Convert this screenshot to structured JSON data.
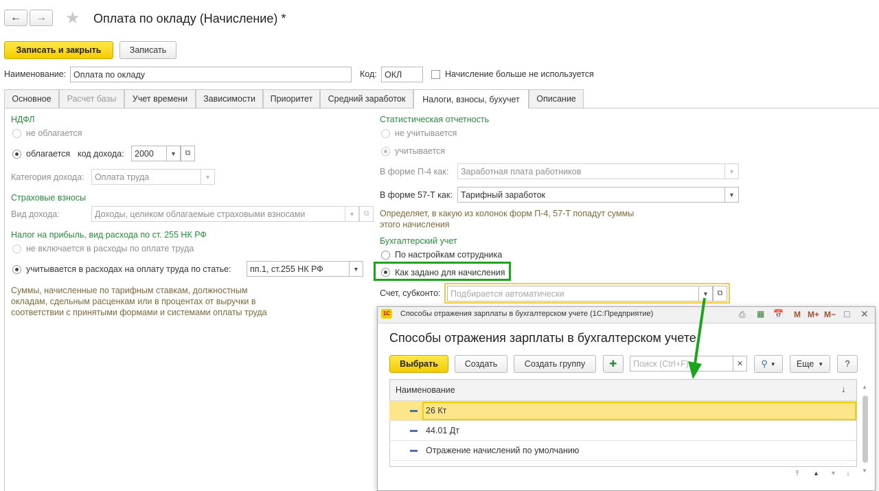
{
  "header": {
    "back_icon": "arrow-left-icon",
    "forward_icon": "arrow-right-icon",
    "star_icon": "star-icon",
    "title": "Оплата по окладу (Начисление) *"
  },
  "toolbar": {
    "save_close": "Записать и закрыть",
    "save": "Записать"
  },
  "top_fields": {
    "name_label": "Наименование:",
    "name_value": "Оплата по окладу",
    "code_label": "Код:",
    "code_value": "ОКЛ",
    "unused_label": "Начисление больше не используется"
  },
  "tabs": [
    "Основное",
    "Расчет базы",
    "Учет времени",
    "Зависимости",
    "Приоритет",
    "Средний заработок",
    "Налоги, взносы, бухучет",
    "Описание"
  ],
  "left": {
    "ndfl_title": "НДФЛ",
    "not_taxed": "не облагается",
    "taxed": "облагается",
    "income_code_label": "код дохода:",
    "income_code_value": "2000",
    "income_category_label": "Категория дохода:",
    "income_category_value": "Оплата труда",
    "insurance_title": "Страховые взносы",
    "income_kind_label": "Вид дохода:",
    "income_kind_value": "Доходы, целиком облагаемые страховыми взносами",
    "profit_tax_title": "Налог на прибыль, вид расхода по ст. 255 НК РФ",
    "not_included": "не включается в расходы по оплате труда",
    "included": "учитывается в расходах на оплату труда по статье:",
    "article_value": "пп.1, ст.255 НК РФ",
    "note": "Суммы, начисленные по тарифным ставкам, должностным\nокладам, сдельным расценкам или в процентах от выручки в\nсоответствии с принятыми формами и системами оплаты труда"
  },
  "right": {
    "stat_title": "Статистическая отчетность",
    "not_counted": "не учитывается",
    "counted": "учитывается",
    "p4_label": "В форме П-4 как:",
    "p4_value": "Заработная плата работников",
    "f57_label": "В форме 57-Т как:",
    "f57_value": "Тарифный заработок",
    "stat_note": "Определяет, в какую из колонок форм П-4, 57-Т попадут суммы\nэтого начисления",
    "acc_title": "Бухгалтерский учет",
    "by_employee": "По настройкам сотрудника",
    "as_accrual": "Как задано для начисления",
    "account_label": "Счет, субконто:",
    "account_placeholder": "Подбирается автоматически"
  },
  "popup": {
    "window_title": "Способы отражения зарплаты в бухгалтерском учете  (1С:Предприятие)",
    "heading": "Способы отражения зарплаты в бухгалтерском учете",
    "select": "Выбрать",
    "create": "Создать",
    "create_group": "Создать группу",
    "search_placeholder": "Поиск (Ctrl+F)",
    "more": "Еще",
    "help": "?",
    "column": "Наименование",
    "tb_m": "M",
    "tb_mplus": "M+",
    "tb_mminus": "M−",
    "rows": [
      "26 Кт",
      "44.01 Дт",
      "Отражение начислений по умолчанию"
    ]
  },
  "colors": {
    "accent_yellow": "#f5d300",
    "highlight_green": "#1aa51a",
    "selected_row": "#fde68a"
  }
}
